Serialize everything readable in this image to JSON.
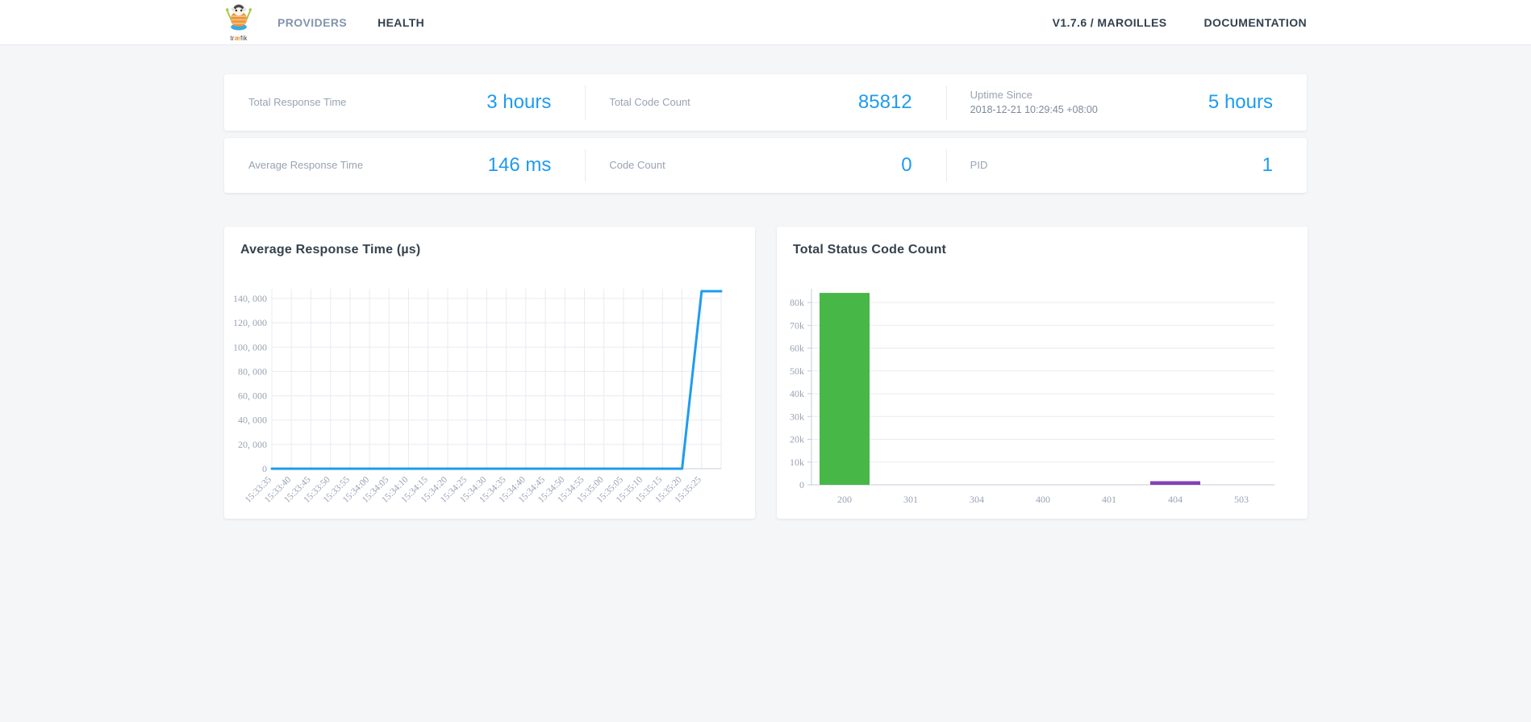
{
  "header": {
    "logo": {
      "p1": "tr",
      "p2": "æ",
      "p3": "fik"
    },
    "nav": {
      "providers": "PROVIDERS",
      "health": "HEALTH"
    },
    "version": "V1.7.6 / MAROILLES",
    "documentation": "DOCUMENTATION"
  },
  "stats": {
    "row1": [
      {
        "label": "Total Response Time",
        "value": "3 hours"
      },
      {
        "label": "Total Code Count",
        "value": "85812"
      },
      {
        "label": "Uptime Since",
        "sublabel": "2018-12-21 10:29:45 +08:00",
        "value": "5 hours"
      }
    ],
    "row2": [
      {
        "label": "Average Response Time",
        "value": "146 ms"
      },
      {
        "label": "Code Count",
        "value": "0"
      },
      {
        "label": "PID",
        "value": "1"
      }
    ]
  },
  "colors": {
    "accent_blue": "#1e9bf0",
    "line_blue": "#1e9cf0",
    "bar_green": "#47b747",
    "bar_purple": "#8641ba",
    "grid": "#e8ebf1",
    "axis": "#c6cdd8",
    "tick_text": "#99a2b4"
  },
  "chart_data": [
    {
      "type": "line",
      "title": "Average Response Time (µs)",
      "x": [
        "15:33:35",
        "15:33:40",
        "15:33:45",
        "15:33:50",
        "15:33:55",
        "15:34:00",
        "15:34:05",
        "15:34:10",
        "15:34:15",
        "15:34:20",
        "15:34:25",
        "15:34:30",
        "15:34:35",
        "15:34:40",
        "15:34:45",
        "15:34:50",
        "15:34:55",
        "15:35:00",
        "15:35:05",
        "15:35:10",
        "15:35:15",
        "15:35:20",
        "15:35:25"
      ],
      "values": [
        0,
        0,
        0,
        0,
        0,
        0,
        0,
        0,
        0,
        0,
        0,
        0,
        0,
        0,
        0,
        0,
        0,
        0,
        0,
        0,
        0,
        0,
        146000,
        146000
      ],
      "ylim": [
        0,
        140000
      ],
      "yticks": [
        {
          "v": 0,
          "label": "0"
        },
        {
          "v": 20000,
          "label": "20, 000"
        },
        {
          "v": 40000,
          "label": "40, 000"
        },
        {
          "v": 60000,
          "label": "60, 000"
        },
        {
          "v": 80000,
          "label": "80, 000"
        },
        {
          "v": 100000,
          "label": "100, 000"
        },
        {
          "v": 120000,
          "label": "120, 000"
        },
        {
          "v": 140000,
          "label": "140, 000"
        }
      ],
      "grid": true,
      "legend": false,
      "note": "flat at 0 from 15:33:35 to 15:35:20, spikes to ~146,000 µs at the end"
    },
    {
      "type": "bar",
      "title": "Total Status Code Count",
      "categories": [
        "200",
        "301",
        "304",
        "400",
        "401",
        "404",
        "503"
      ],
      "values": [
        84200,
        0,
        0,
        0,
        0,
        1600,
        0
      ],
      "bar_colors": [
        "#47b747",
        "",
        "",
        "",
        "",
        "#8641ba",
        ""
      ],
      "ylim": [
        0,
        86000
      ],
      "yticks": [
        {
          "v": 0,
          "label": "0"
        },
        {
          "v": 10000,
          "label": "10k"
        },
        {
          "v": 20000,
          "label": "20k"
        },
        {
          "v": 30000,
          "label": "30k"
        },
        {
          "v": 40000,
          "label": "40k"
        },
        {
          "v": 50000,
          "label": "50k"
        },
        {
          "v": 60000,
          "label": "60k"
        },
        {
          "v": 70000,
          "label": "70k"
        },
        {
          "v": 80000,
          "label": "80k"
        }
      ],
      "grid": true,
      "legend": false
    }
  ]
}
